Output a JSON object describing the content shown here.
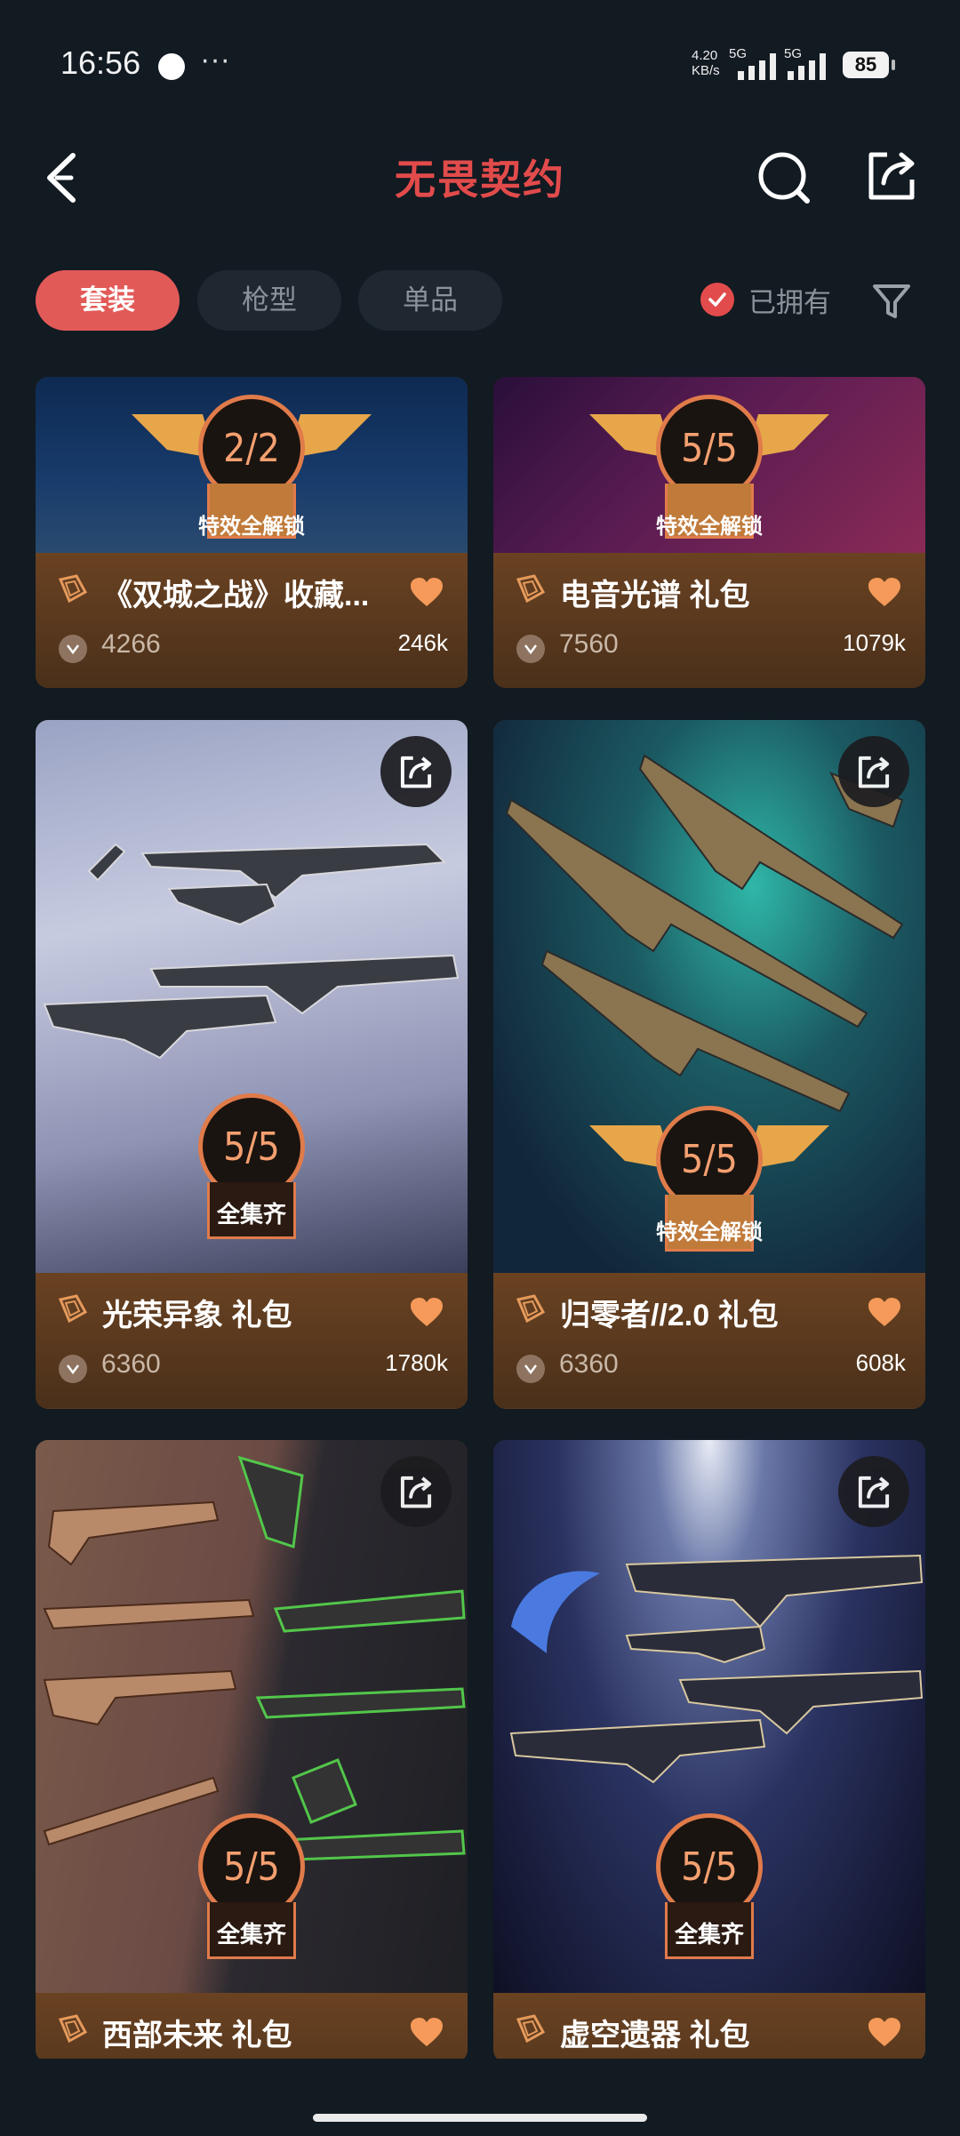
{
  "status": {
    "time": "16:56",
    "dots": "···",
    "speed_top": "4.20",
    "speed_unit": "KB/s",
    "net1": "5G",
    "net2": "5G",
    "battery": "85"
  },
  "header": {
    "title": "无畏契约"
  },
  "filters": {
    "tabs": [
      "套装",
      "枪型",
      "单品"
    ],
    "owned_label": "已拥有"
  },
  "cards": [
    {
      "title": "《双城之战》收藏...",
      "price": "4266",
      "likes": "246k",
      "badge": "2/2",
      "badge_label": "特效全解锁"
    },
    {
      "title": "电音光谱 礼包",
      "price": "7560",
      "likes": "1079k",
      "badge": "5/5",
      "badge_label": "特效全解锁"
    },
    {
      "title": "光荣异象 礼包",
      "price": "6360",
      "likes": "1780k",
      "badge": "5/5",
      "badge_label": "全集齐"
    },
    {
      "title": "归零者//2.0 礼包",
      "price": "6360",
      "likes": "608k",
      "badge": "5/5",
      "badge_label": "特效全解锁"
    },
    {
      "title": "西部未来 礼包",
      "price": "",
      "likes": "",
      "badge": "5/5",
      "badge_label": "全集齐"
    },
    {
      "title": "虚空遗器 礼包",
      "price": "",
      "likes": "",
      "badge": "5/5",
      "badge_label": "全集齐"
    }
  ],
  "colors": {
    "accent": "#e25a58",
    "badge_orange": "#e07b4a",
    "background": "#121a22"
  },
  "icons": {
    "back": "back-arrow-icon",
    "search": "search-icon",
    "share": "share-icon",
    "filter": "filter-funnel-icon",
    "heart": "heart-icon",
    "coin": "vp-coin-icon",
    "tag": "bundle-tag-icon"
  }
}
